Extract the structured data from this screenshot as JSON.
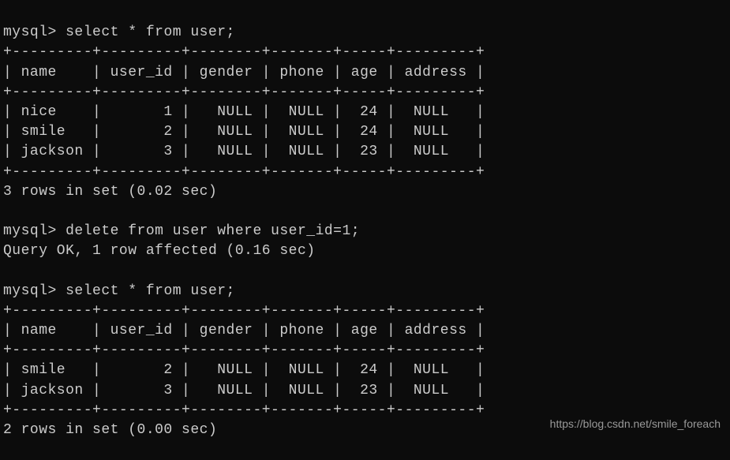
{
  "terminal": {
    "prompt": "mysql>",
    "commands": {
      "select1": "select * from user;",
      "delete": "delete from user where user_id=1;",
      "select2": "select * from user;"
    },
    "table1": {
      "border_top": "+---------+---------+--------+-------+-----+---------+",
      "header": "| name    | user_id | gender | phone | age | address |",
      "border_mid": "+---------+---------+--------+-------+-----+---------+",
      "rows": [
        "| nice    |       1 |   NULL |  NULL |  24 |  NULL   |",
        "| smile   |       2 |   NULL |  NULL |  24 |  NULL   |",
        "| jackson |       3 |   NULL |  NULL |  23 |  NULL   |"
      ],
      "border_bot": "+---------+---------+--------+-------+-----+---------+",
      "result": "3 rows in set (0.02 sec)"
    },
    "delete_result": "Query OK, 1 row affected (0.16 sec)",
    "table2": {
      "border_top": "+---------+---------+--------+-------+-----+---------+",
      "header": "| name    | user_id | gender | phone | age | address |",
      "border_mid": "+---------+---------+--------+-------+-----+---------+",
      "rows": [
        "| smile   |       2 |   NULL |  NULL |  24 |  NULL   |",
        "| jackson |       3 |   NULL |  NULL |  23 |  NULL   |"
      ],
      "border_bot": "+---------+---------+--------+-------+-----+---------+",
      "result": "2 rows in set (0.00 sec)"
    }
  },
  "watermark": "https://blog.csdn.net/smile_foreach",
  "chart_data": {
    "type": "table",
    "tables": [
      {
        "title": "user (before delete)",
        "columns": [
          "name",
          "user_id",
          "gender",
          "phone",
          "age",
          "address"
        ],
        "rows": [
          [
            "nice",
            1,
            null,
            null,
            24,
            null
          ],
          [
            "smile",
            2,
            null,
            null,
            24,
            null
          ],
          [
            "jackson",
            3,
            null,
            null,
            23,
            null
          ]
        ]
      },
      {
        "title": "user (after delete user_id=1)",
        "columns": [
          "name",
          "user_id",
          "gender",
          "phone",
          "age",
          "address"
        ],
        "rows": [
          [
            "smile",
            2,
            null,
            null,
            24,
            null
          ],
          [
            "jackson",
            3,
            null,
            null,
            23,
            null
          ]
        ]
      }
    ]
  }
}
